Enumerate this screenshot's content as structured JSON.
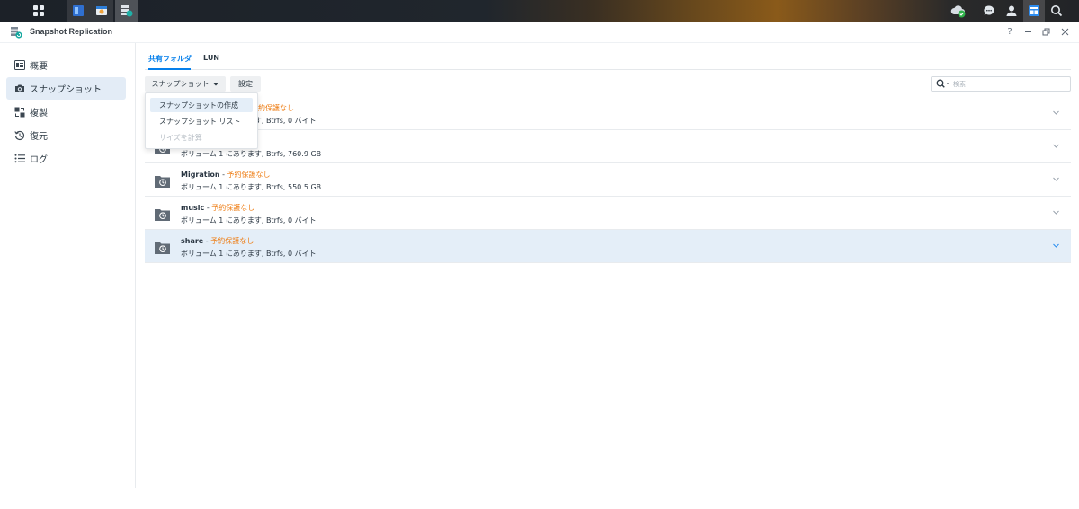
{
  "app": {
    "title": "Snapshot Replication"
  },
  "window_controls": {
    "help": "?"
  },
  "sidebar": {
    "items": [
      {
        "label": "概要",
        "icon": "overview-icon"
      },
      {
        "label": "スナップショット",
        "icon": "camera-icon",
        "active": true
      },
      {
        "label": "複製",
        "icon": "replication-icon"
      },
      {
        "label": "復元",
        "icon": "restore-icon"
      },
      {
        "label": "ログ",
        "icon": "log-list-icon"
      }
    ]
  },
  "tabs": [
    {
      "label": "共有フォルダ",
      "active": true
    },
    {
      "label": "LUN",
      "active": false
    }
  ],
  "toolbar": {
    "snapshot_label": "スナップショット",
    "settings_label": "設定",
    "search_placeholder": "検索"
  },
  "dropdown": {
    "items": [
      {
        "label": "スナップショットの作成",
        "state": "hover"
      },
      {
        "label": "スナップショット リスト",
        "state": "normal"
      },
      {
        "label": "サイズを計算",
        "state": "disabled"
      }
    ]
  },
  "rows": [
    {
      "name": "",
      "status": "予約保護なし",
      "detail": "ボリューム 1 にあります, Btrfs, 0 バイト",
      "partially_hidden": true
    },
    {
      "name": "",
      "status": "",
      "detail": "ボリューム 1 にあります, Btrfs, 760.9 GB",
      "partially_hidden": true
    },
    {
      "name": "Migration",
      "sep": " - ",
      "status": "予約保護なし",
      "detail": "ボリューム 1 にあります, Btrfs, 550.5 GB"
    },
    {
      "name": "music",
      "sep": " - ",
      "status": "予約保護なし",
      "detail": "ボリューム 1 にあります, Btrfs, 0 バイト"
    },
    {
      "name": "share",
      "sep": " - ",
      "status": "予約保護なし",
      "detail": "ボリューム 1 にあります, Btrfs, 0 バイト",
      "selected": true
    }
  ],
  "colors": {
    "accent": "#057feb",
    "status_orange": "#ee7d14",
    "selection_bg": "#e4eef8"
  }
}
